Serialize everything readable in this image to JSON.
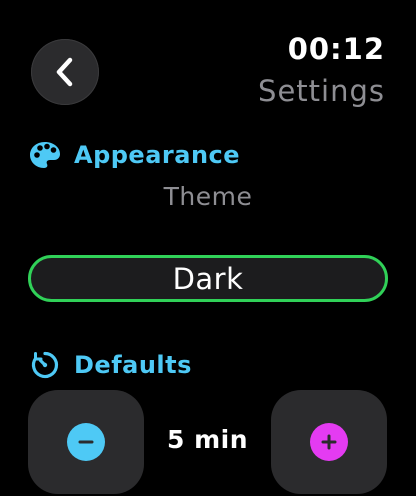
{
  "header": {
    "time": "00:12",
    "title": "Settings",
    "back_icon": "chevron-left-icon"
  },
  "appearance": {
    "section_label": "Appearance",
    "icon": "palette-icon",
    "theme_label": "Theme",
    "theme_value": "Dark"
  },
  "defaults": {
    "section_label": "Defaults",
    "icon": "timer-icon",
    "duration_value": "5 min",
    "decrement_icon": "minus-icon",
    "increment_icon": "plus-icon"
  },
  "colors": {
    "accent": "#4ec9f5",
    "toggle_border": "#30d158",
    "decrement": "#4ec9f5",
    "increment": "#e43bf2",
    "secondary_text": "#8e8e93"
  }
}
